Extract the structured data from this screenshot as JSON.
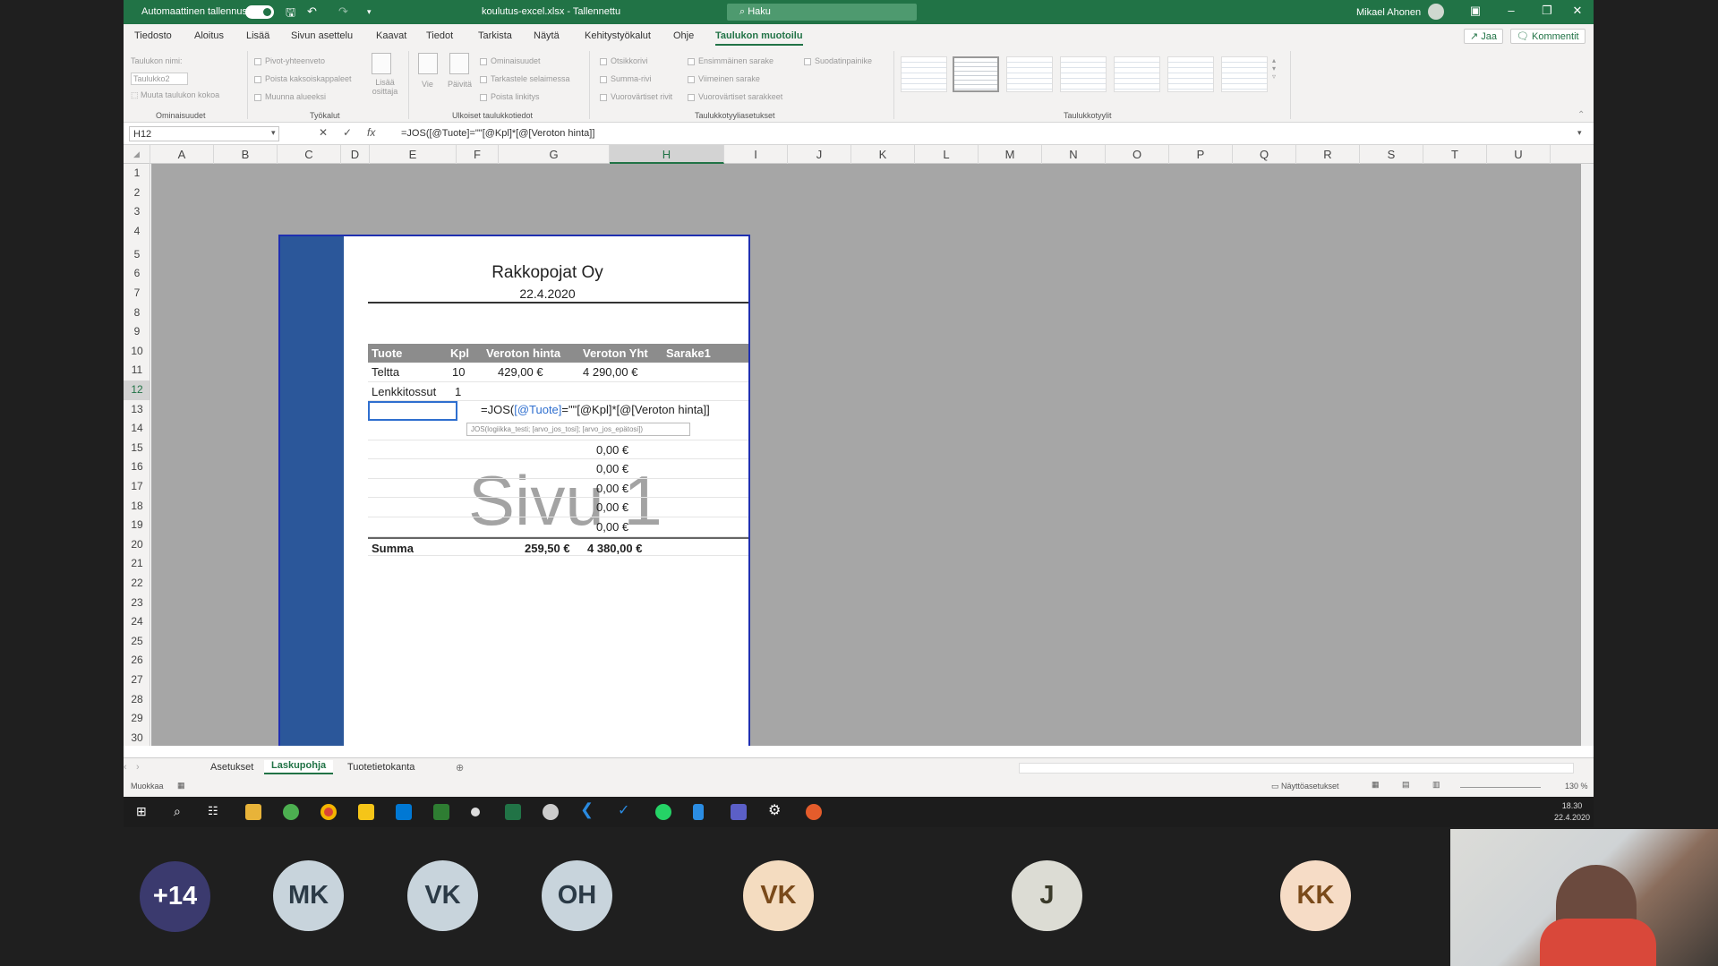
{
  "titlebar": {
    "autosave_label": "Automaattinen tallennus",
    "doc_title": "koulutus-excel.xlsx - Tallennettu",
    "search_placeholder": "Haku",
    "user_name": "Mikael Ahonen"
  },
  "tabs": [
    "Tiedosto",
    "Aloitus",
    "Lisää",
    "Sivun asettelu",
    "Kaavat",
    "Tiedot",
    "Tarkista",
    "Näytä",
    "Kehitystyökalut",
    "Ohje",
    "Taulukon muotoilu"
  ],
  "share_label": "Jaa",
  "comments_label": "Kommentit",
  "ribbon": {
    "table_name_label": "Taulukon nimi:",
    "table_name_value": "Taulukko2",
    "resize_label": "Muuta taulukon kokoa",
    "group_properties": "Ominaisuudet",
    "pivot_label": "Pivot-yhteenveto",
    "remove_dup_label": "Poista kaksoiskappaleet",
    "convert_label": "Muunna alueeksi",
    "slicer_label": "Lisää osittaja",
    "group_tools": "Työkalut",
    "export_label": "Vie",
    "refresh_label": "Päivitä",
    "props_label": "Ominaisuudet",
    "browser_label": "Tarkastele selaimessa",
    "unlink_label": "Poista linkitys",
    "group_external": "Ulkoiset taulukkotiedot",
    "header_row": "Otsikkorivi",
    "total_row": "Summa-rivi",
    "banded_rows": "Vuorovärtiset rivit",
    "first_col": "Ensimmäinen sarake",
    "last_col": "Viimeinen sarake",
    "banded_cols": "Vuorovärtiset sarakkeet",
    "filter_btn": "Suodatinpainike",
    "group_style_opts": "Taulukkotyyliasetukset",
    "group_styles": "Taulukkotyylit"
  },
  "formula_bar": {
    "name_box": "H12",
    "formula": "=JOS([@Tuote]=\"\"[@Kpl]*[@[Veroton hinta]]"
  },
  "columns": [
    "A",
    "B",
    "C",
    "D",
    "E",
    "F",
    "G",
    "H",
    "I",
    "J",
    "K",
    "L",
    "M",
    "N",
    "O",
    "P",
    "Q",
    "R",
    "S",
    "T",
    "U"
  ],
  "rows": [
    "1",
    "2",
    "3",
    "4",
    "5",
    "6",
    "7",
    "8",
    "9",
    "10",
    "11",
    "12",
    "13",
    "14",
    "15",
    "16",
    "17",
    "18",
    "19",
    "20",
    "21",
    "22",
    "23",
    "24",
    "25",
    "26",
    "27",
    "28",
    "29",
    "30"
  ],
  "invoice": {
    "company": "Rakkopojat Oy",
    "date": "22.4.2020",
    "headers": [
      "Tuote",
      "Kpl",
      "Veroton hinta",
      "Veroton Yht",
      "Sarake1"
    ],
    "rows": [
      [
        "Teltta",
        "10",
        "429,00 €",
        "4 290,00 €"
      ],
      [
        "Lenkkitossut",
        "1",
        "",
        ""
      ]
    ],
    "formula_parts": {
      "pre": "=JOS(",
      "ref1": "[@Tuote]",
      "mid": "=\"\"",
      "rest": "[@Kpl]*[@[Veroton hinta]]"
    },
    "tooltip": "JOS(logiikka_testi; [arvo_jos_tosi]; [arvo_jos_epätosi])",
    "empty_totals": [
      "0,00 €",
      "0,00 €",
      "0,00 €",
      "0,00 €",
      "0,00 €"
    ],
    "sum_label": "Summa",
    "sum_price": "259,50 €",
    "sum_total": "4 380,00 €",
    "watermark": "Sivu 1"
  },
  "sheet_tabs": [
    "Asetukset",
    "Laskupohja",
    "Tuotetietokanta"
  ],
  "status": {
    "mode": "Muokkaa",
    "display_settings": "Näyttöasetukset",
    "zoom": "130 %"
  },
  "clock": {
    "time": "18.30",
    "date": "22.4.2020"
  },
  "participants": [
    {
      "initials": "+14",
      "bg": "#3b3a6e",
      "fg": "#ffffff"
    },
    {
      "initials": "MK",
      "bg": "#c8d4dc",
      "fg": "#2b3a46"
    },
    {
      "initials": "VK",
      "bg": "#c8d4dc",
      "fg": "#2b3a46"
    },
    {
      "initials": "OH",
      "bg": "#c8d4dc",
      "fg": "#2b3a46"
    },
    {
      "initials": "VK",
      "bg": "#f4dcc0",
      "fg": "#7a4a1a"
    },
    {
      "initials": "J",
      "bg": "#dcdcd4",
      "fg": "#3a3a2a"
    },
    {
      "initials": "KK",
      "bg": "#f6dcc6",
      "fg": "#7a4a1a"
    }
  ],
  "colors": {
    "excel_green": "#217346",
    "accent_blue": "#2b579a",
    "table_header": "#8c8c8c"
  }
}
